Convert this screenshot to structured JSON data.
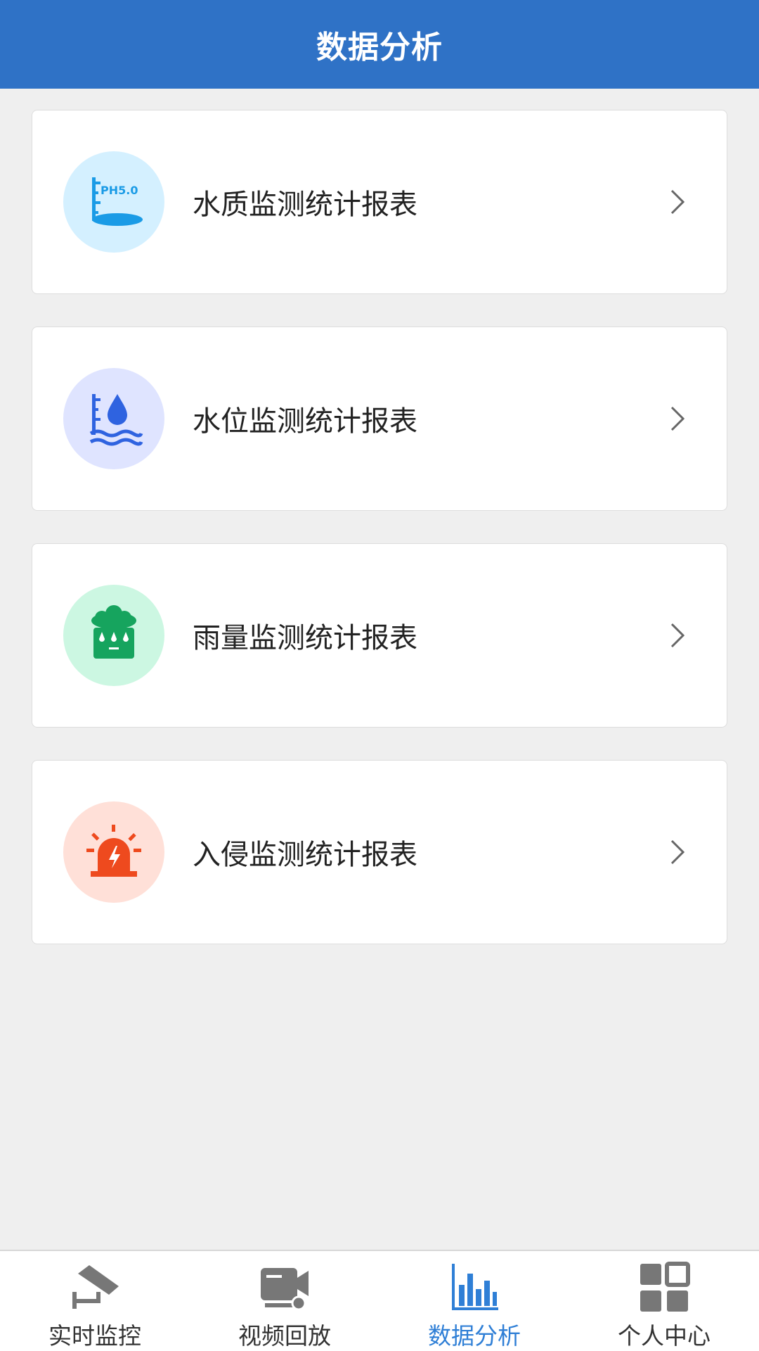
{
  "header": {
    "title": "数据分析",
    "bg_color": "#2f72c6"
  },
  "reports": [
    {
      "label": "水质监测统计报表",
      "icon": "ph-meter-icon",
      "icon_text": "PH5.0",
      "icon_bg": "#d4f0ff",
      "icon_color": "#1a9be6"
    },
    {
      "label": "水位监测统计报表",
      "icon": "water-level-icon",
      "icon_bg": "#dfe4ff",
      "icon_color": "#2f63e0"
    },
    {
      "label": "雨量监测统计报表",
      "icon": "rain-gauge-icon",
      "icon_bg": "#ccf7e2",
      "icon_color": "#16a45e"
    },
    {
      "label": "入侵监测统计报表",
      "icon": "alarm-light-icon",
      "icon_bg": "#ffe0d8",
      "icon_color": "#ee4a1e"
    }
  ],
  "tabbar": {
    "active_color": "#2f7fd6",
    "items": [
      {
        "label": "实时监控",
        "icon": "cctv-camera-icon",
        "active": false
      },
      {
        "label": "视频回放",
        "icon": "video-camera-icon",
        "active": false
      },
      {
        "label": "数据分析",
        "icon": "bar-chart-icon",
        "active": true
      },
      {
        "label": "个人中心",
        "icon": "grid-icon",
        "active": false
      }
    ]
  }
}
